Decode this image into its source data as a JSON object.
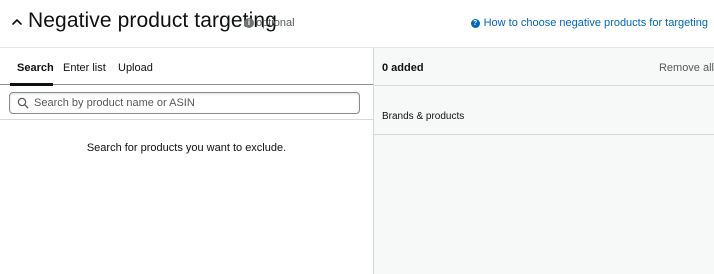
{
  "header": {
    "title": "Negative product targeting",
    "info_icon": "info-icon",
    "optional_label": "optional",
    "help_link": "How to choose negative products for targeting",
    "help_icon": "question-circle-icon",
    "collapse_icon": "chevron-up-icon"
  },
  "tabs": [
    {
      "label": "Search",
      "active": true
    },
    {
      "label": "Enter list",
      "active": false
    },
    {
      "label": "Upload",
      "active": false
    }
  ],
  "search": {
    "placeholder": "Search by product name or ASIN",
    "value": "",
    "icon": "search-icon"
  },
  "empty_state": {
    "message": "Search for products you want to exclude."
  },
  "added_panel": {
    "count_label": "0 added",
    "remove_all_label": "Remove all",
    "column_header": "Brands & products"
  },
  "colors": {
    "link": "#0066c0",
    "text": "#0f1111",
    "muted": "#565959",
    "panel_bg": "#f7f8f8",
    "border": "#d5d9d9"
  }
}
